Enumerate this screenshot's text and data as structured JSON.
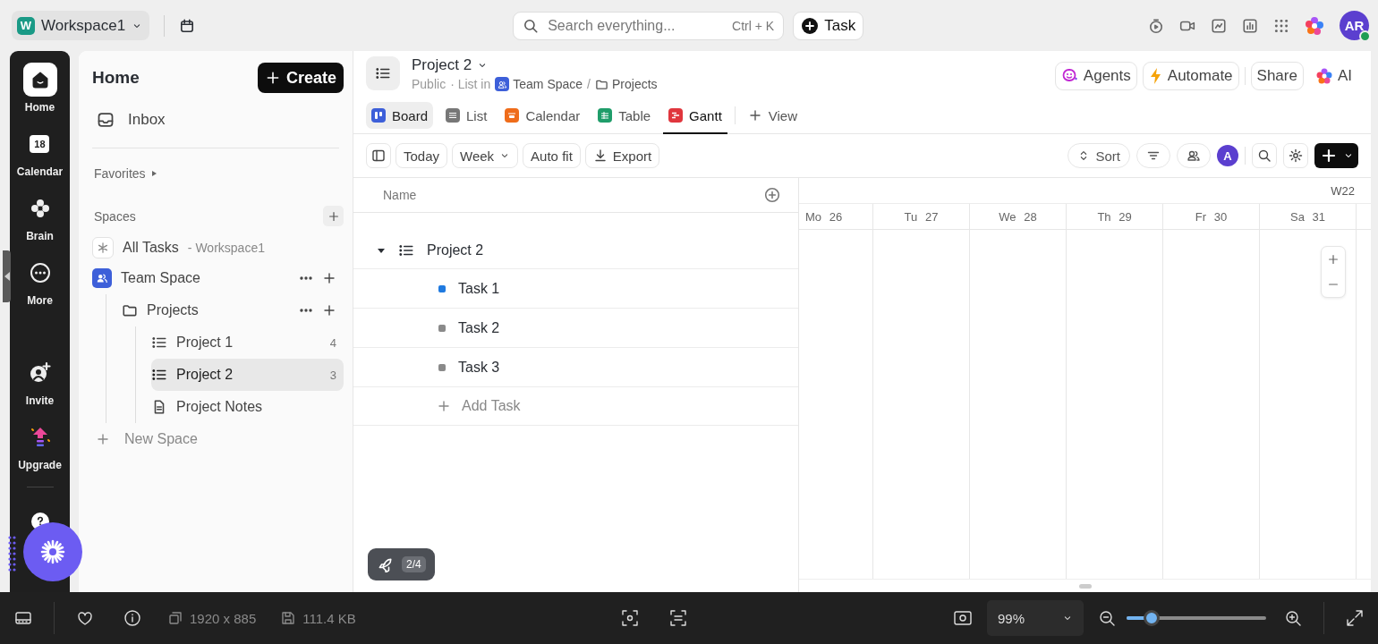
{
  "top_bar": {
    "workspace": {
      "logo": "W",
      "name": "Workspace1"
    },
    "search": {
      "placeholder": "Search everything...",
      "shortcut": "Ctrl + K"
    },
    "task_button": "Task",
    "avatar": "AR"
  },
  "rail": [
    {
      "label": "Home",
      "selected": true
    },
    {
      "label": "Calendar",
      "icon_text": "18",
      "selected": false
    },
    {
      "label": "Brain",
      "selected": false
    },
    {
      "label": "More",
      "selected": false
    },
    {
      "label": "Invite",
      "selected": false
    },
    {
      "label": "Upgrade",
      "selected": false
    }
  ],
  "sidebar": {
    "title": "Home",
    "create": "Create",
    "inbox": "Inbox",
    "favorites": "Favorites",
    "spaces_heading": "Spaces",
    "all_tasks": {
      "label": "All Tasks",
      "scope": "- Workspace1"
    },
    "tree": [
      {
        "kind": "space",
        "label": "Team Space",
        "selected": false,
        "children": [
          {
            "kind": "folder",
            "label": "Projects",
            "selected": false,
            "children": [
              {
                "kind": "list",
                "label": "Project 1",
                "count": "4",
                "selected": false
              },
              {
                "kind": "list",
                "label": "Project 2",
                "count": "3",
                "selected": true
              },
              {
                "kind": "doc",
                "label": "Project Notes",
                "selected": false
              }
            ]
          }
        ]
      }
    ],
    "new_space": "New Space"
  },
  "header": {
    "title": "Project 2",
    "visibility": "Public",
    "location": "· List in",
    "breadcrumb": [
      "Team Space",
      "Projects"
    ],
    "separator": "/",
    "actions": [
      "Agents",
      "Automate",
      "Share",
      "AI"
    ]
  },
  "views": [
    {
      "kind": "board",
      "label": "Board",
      "selected": false,
      "highlighted": true
    },
    {
      "kind": "list",
      "label": "List",
      "selected": false,
      "highlighted": false
    },
    {
      "kind": "calendar",
      "label": "Calendar",
      "selected": false,
      "highlighted": false
    },
    {
      "kind": "table",
      "label": "Table",
      "selected": false,
      "highlighted": false
    },
    {
      "kind": "gantt",
      "label": "Gantt",
      "selected": true,
      "highlighted": false
    }
  ],
  "add_view": "View",
  "toolbar": {
    "left": [
      "Today",
      "Week",
      "Auto fit",
      "Export"
    ],
    "sort": "Sort",
    "assignee": "A"
  },
  "gantt": {
    "name_column": "Name",
    "group": {
      "label": "Project 2",
      "expanded": true
    },
    "tasks": [
      {
        "name": "Task 1",
        "color": "#1f7ae0"
      },
      {
        "name": "Task 2",
        "color": "#8a8a8a"
      },
      {
        "name": "Task 3",
        "color": "#8a8a8a"
      }
    ],
    "add_task": "Add Task",
    "week": "W22",
    "days": [
      "Mo 26",
      "Tu 27",
      "We 28",
      "Th 29",
      "Fr 30",
      "Sa 31"
    ]
  },
  "onboarding": {
    "progress": "2/4"
  },
  "viewer": {
    "dimensions": "1920 x 885",
    "file_size": "111.4 KB",
    "zoom": "99%",
    "zoom_slider": {
      "level": 0.18
    }
  }
}
